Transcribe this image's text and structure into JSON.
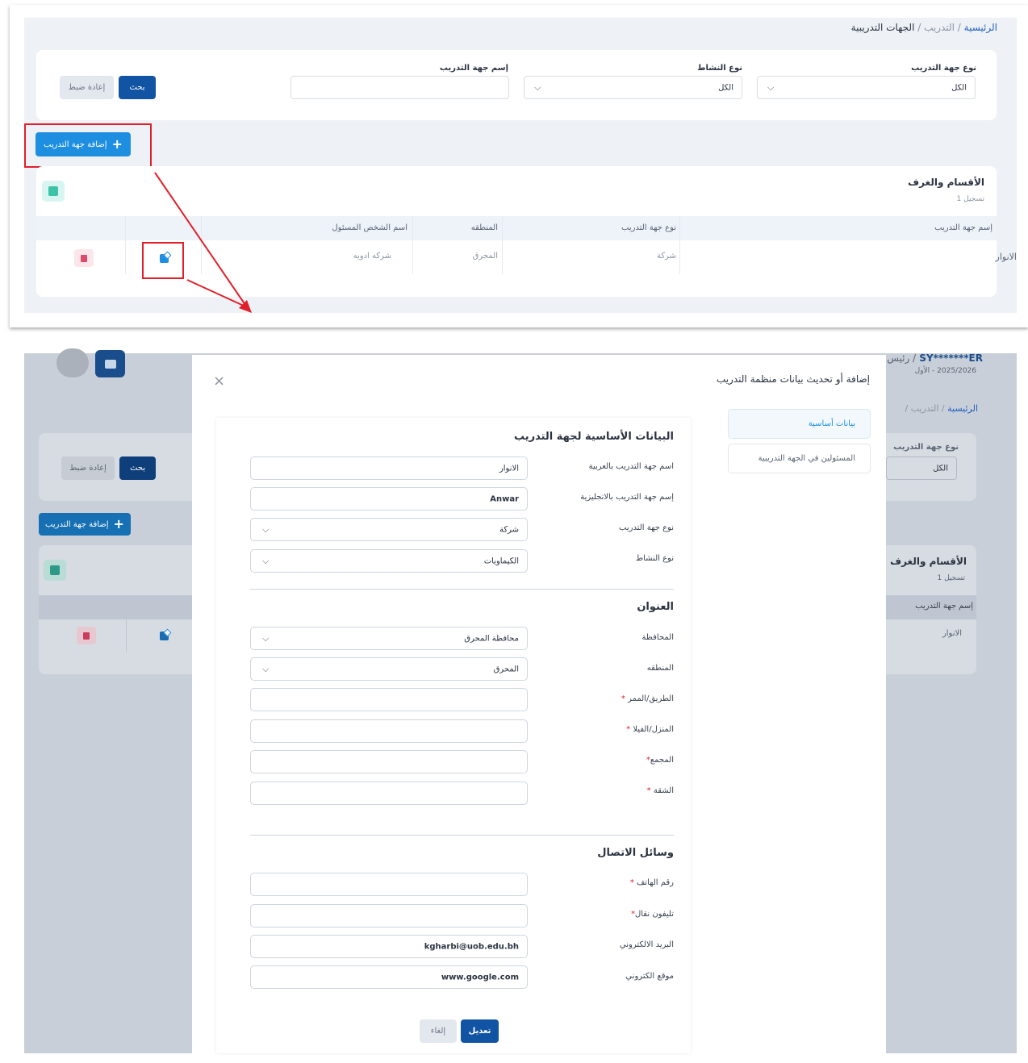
{
  "top": {
    "breadcrumb": {
      "home": "الرئيسية",
      "sep": "/",
      "parent": "التدريب",
      "current": "الجهات التدريبية"
    },
    "filters": {
      "type_label": "نوع جهة التدريب",
      "type_value": "الكل",
      "activity_label": "نوع النشاط",
      "activity_value": "الكل",
      "name_label": "إسم جهة التدريب",
      "name_value": "",
      "search_button": "بحث",
      "reset_button": "إعادة ضبط"
    },
    "add_button": "إضافة جهة التدريب",
    "section": {
      "title": "الأقسام والغرف",
      "count": "1 تسجيل"
    },
    "table": {
      "headers": [
        "إسم جهة التدريب",
        "نوع جهة التدريب",
        "المنطقه",
        "اسم الشخص المسئول"
      ],
      "rows": [
        {
          "name": "الانوار",
          "type": "شركة",
          "region": "المحرق",
          "contact": "شركه ادويه"
        }
      ]
    }
  },
  "bottom": {
    "background": {
      "user": "SY*******ER",
      "user_suffix": "/ رئيس",
      "term": "2025/2026 - الأول",
      "breadcrumb_home": "الرئيسية",
      "breadcrumb_parent": "التدريب",
      "filter_label": "نوع جهة التدريب",
      "filter_value": "الكل",
      "search_button": "بحث",
      "reset_button": "إعادة ضبط",
      "add_button": "إضافة جهة التدريب",
      "section_title": "الأقسام والغرف",
      "section_count": "1 تسجيل",
      "col_header": "إسم جهة التدريب",
      "row_name": "الانوار"
    },
    "modal": {
      "title": "إضافة أو تحديث بيانات منظمة التدريب",
      "close": "×",
      "tabs": [
        "بيانات أساسية",
        "المسئولين في الجهة التدريبية"
      ],
      "basic": {
        "title": "البيانات الأساسية لجهة التدريب",
        "fields": [
          {
            "label": "اسم جهة التدريب بالعربية",
            "value": "الانوار",
            "select": false
          },
          {
            "label": "إسم جهة التدريب بالانجليزية",
            "value": "Anwar",
            "select": false
          },
          {
            "label": "نوع جهة التدريب",
            "value": "شركة",
            "select": true
          },
          {
            "label": "نوع النشاط",
            "value": "الكيماويات",
            "select": true
          }
        ]
      },
      "address": {
        "title": "العنوان",
        "fields": [
          {
            "label": "المحافظة",
            "value": "محافظة المحرق",
            "select": true,
            "required": false
          },
          {
            "label": "المنطقه",
            "value": "المحرق",
            "select": true,
            "required": false
          },
          {
            "label": "الطريق/الممر",
            "value": "",
            "select": false,
            "required": true
          },
          {
            "label": "المنزل/الفيلا",
            "value": "",
            "select": false,
            "required": true
          },
          {
            "label": "المجمع",
            "value": "",
            "select": false,
            "required": true
          },
          {
            "label": "الشقة",
            "value": "",
            "select": false,
            "required": true
          }
        ]
      },
      "contact": {
        "title": "وسائل الاتصال",
        "fields": [
          {
            "label": "رقم الهاتف",
            "value": "",
            "required": true
          },
          {
            "label": "تليفون نقال",
            "value": "",
            "required": true
          },
          {
            "label": "البريد الالكتروني",
            "value": "kgharbi@uob.edu.bh",
            "required": false
          },
          {
            "label": "موقع الكتروني",
            "value": "www.google.com",
            "required": false
          }
        ]
      },
      "submit_button": "تعديل",
      "cancel_button": "إلغاء"
    }
  },
  "colors": {
    "primary": "#1254a4",
    "accent": "#1e8fe0",
    "annotation": "#e0202a"
  }
}
